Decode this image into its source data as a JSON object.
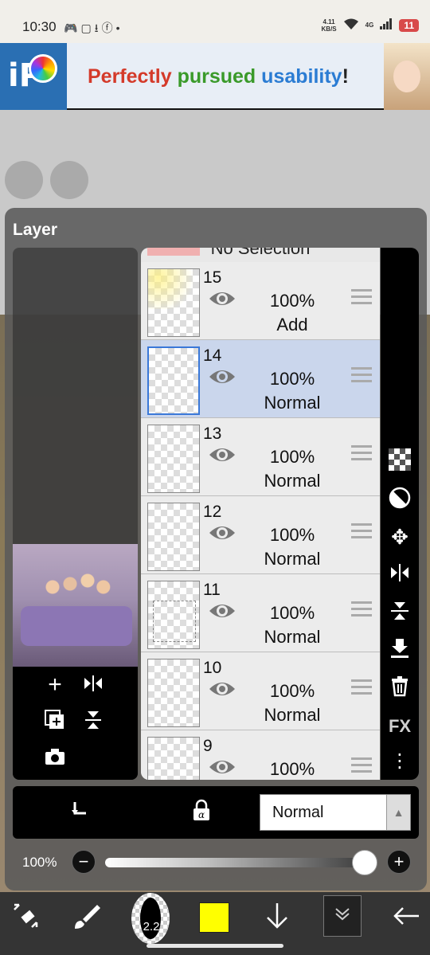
{
  "status_bar": {
    "time": "10:30",
    "left_icons": [
      "game-icon",
      "screenshot-icon",
      "download-icon",
      "facebook-icon",
      "dot-icon"
    ],
    "net_speed_value": "4.11",
    "net_speed_unit": "KB/S",
    "signal": "4G",
    "battery": "11"
  },
  "ad": {
    "logo_text": "iP",
    "headline_1": "Perfectly",
    "headline_2": "pursued",
    "headline_3": "usability",
    "headline_4": "!"
  },
  "layer_panel": {
    "title": "Layer",
    "no_selection": "No Selection",
    "layers": [
      {
        "number": "15",
        "opacity": "100%",
        "mode": "Add",
        "selected": false
      },
      {
        "number": "14",
        "opacity": "100%",
        "mode": "Normal",
        "selected": true
      },
      {
        "number": "13",
        "opacity": "100%",
        "mode": "Normal",
        "selected": false
      },
      {
        "number": "12",
        "opacity": "100%",
        "mode": "Normal",
        "selected": false
      },
      {
        "number": "11",
        "opacity": "100%",
        "mode": "Normal",
        "selected": false
      },
      {
        "number": "10",
        "opacity": "100%",
        "mode": "Normal",
        "selected": false
      },
      {
        "number": "9",
        "opacity": "100%",
        "mode": "",
        "selected": false
      }
    ],
    "side_tools": [
      "checker-icon",
      "invert-icon",
      "move-icon",
      "flip-horizontal-icon",
      "flip-vertical-icon",
      "merge-down-icon",
      "trash-icon",
      "FX",
      "more-icon"
    ],
    "fx_label": "FX",
    "blend_mode": "Normal",
    "opacity_label": "100%",
    "opacity_value": 1.0
  },
  "bottom_toolbar": {
    "brush_size": "2.2",
    "color": "#ffff00"
  }
}
